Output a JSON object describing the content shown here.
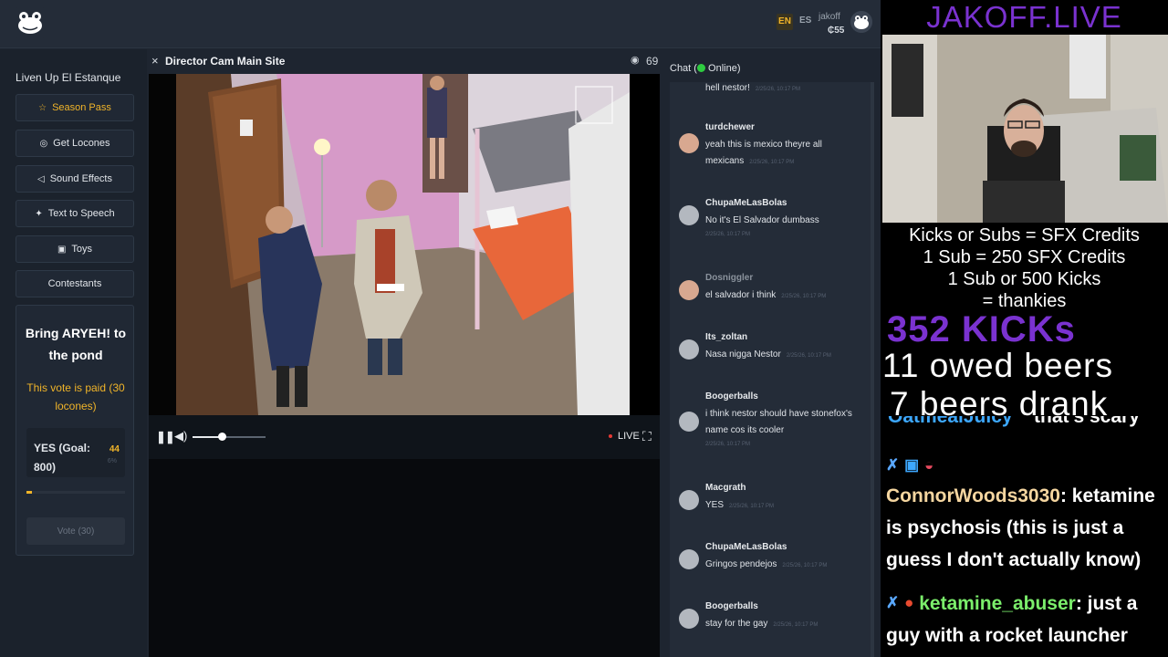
{
  "header": {
    "lang_active": "EN",
    "lang_other": "ES",
    "username": "jakoff",
    "balance": "₵55"
  },
  "sidebar": {
    "title": "Liven Up El Estanque",
    "buttons": [
      {
        "label": "Season Pass",
        "icon": "star-icon"
      },
      {
        "label": "Get Locones",
        "icon": "coin-icon"
      },
      {
        "label": "Sound Effects",
        "icon": "speaker-icon"
      },
      {
        "label": "Text to Speech",
        "icon": "sparkle-icon"
      },
      {
        "label": "Toys",
        "icon": "gift-icon"
      },
      {
        "label": "Contestants",
        "icon": ""
      }
    ],
    "vote": {
      "title": "Bring ARYEH! to the pond",
      "paid_note": "This vote is paid (30 locones)",
      "option_label": "YES (Goal: 800)",
      "option_count": "44",
      "option_pct": "6%",
      "progress": 0.06,
      "vote_button": "Vote (30)"
    }
  },
  "video": {
    "close": "×",
    "title": "Director Cam Main Site",
    "viewers": "69",
    "live_label": "LIVE",
    "volume": 0.4
  },
  "chat": {
    "title": "Chat (",
    "status": " Online)",
    "messages": [
      {
        "user": "",
        "text": "hell nestor!",
        "time": "2/25/26, 10:17 PM"
      },
      {
        "user": "turdchewer",
        "text": "yeah this is mexico theyre all mexicans",
        "time": "2/25/26, 10:17 PM"
      },
      {
        "user": "ChupaMeLasBolas",
        "text": "No it's El Salvador dumbass",
        "time": "2/25/26, 10:17 PM"
      },
      {
        "user": "Dosniggler",
        "text": "el salvador i think",
        "time": "2/25/26, 10:17 PM"
      },
      {
        "user": "Its_zoltan",
        "text": "Nasa nigga Nestor",
        "time": "2/25/26, 10:17 PM"
      },
      {
        "user": "Boogerballs",
        "text": "i think nestor should have stonefox's name cos its cooler",
        "time": "2/25/26, 10:17 PM"
      },
      {
        "user": "Macgrath",
        "text": "YES",
        "time": "2/25/26, 10:17 PM"
      },
      {
        "user": "ChupaMeLasBolas",
        "text": "Gringos pendejos",
        "time": "2/25/26, 10:17 PM"
      },
      {
        "user": "Boogerballs",
        "text": "stay for the gay",
        "time": "2/25/26, 10:17 PM"
      }
    ]
  },
  "overlay": {
    "title": "JAKOFF.LIVE",
    "line1": "Kicks or Subs = SFX Credits",
    "line2": "1 Sub = 250 SFX Credits",
    "line3": "1 Sub or 500 Kicks",
    "line4": "= thankies",
    "kicks": "352 KICKs",
    "owed": "11 owed beers",
    "drank": "7 beers drank",
    "kick_chat": [
      {
        "user": "OatmealJuicy",
        "text": "that's scary"
      },
      {
        "user": "ConnorWoods3030",
        "text": "ketamine is psychosis (this is just a guess I don't actually know)"
      },
      {
        "user": "ketamine_abuser",
        "text": "just a guy with a rocket launcher"
      }
    ]
  },
  "colors": {
    "accent": "#f0b429",
    "brand_purple": "#7a32d0",
    "online": "#2ecc40",
    "live_dot": "#e53935"
  }
}
